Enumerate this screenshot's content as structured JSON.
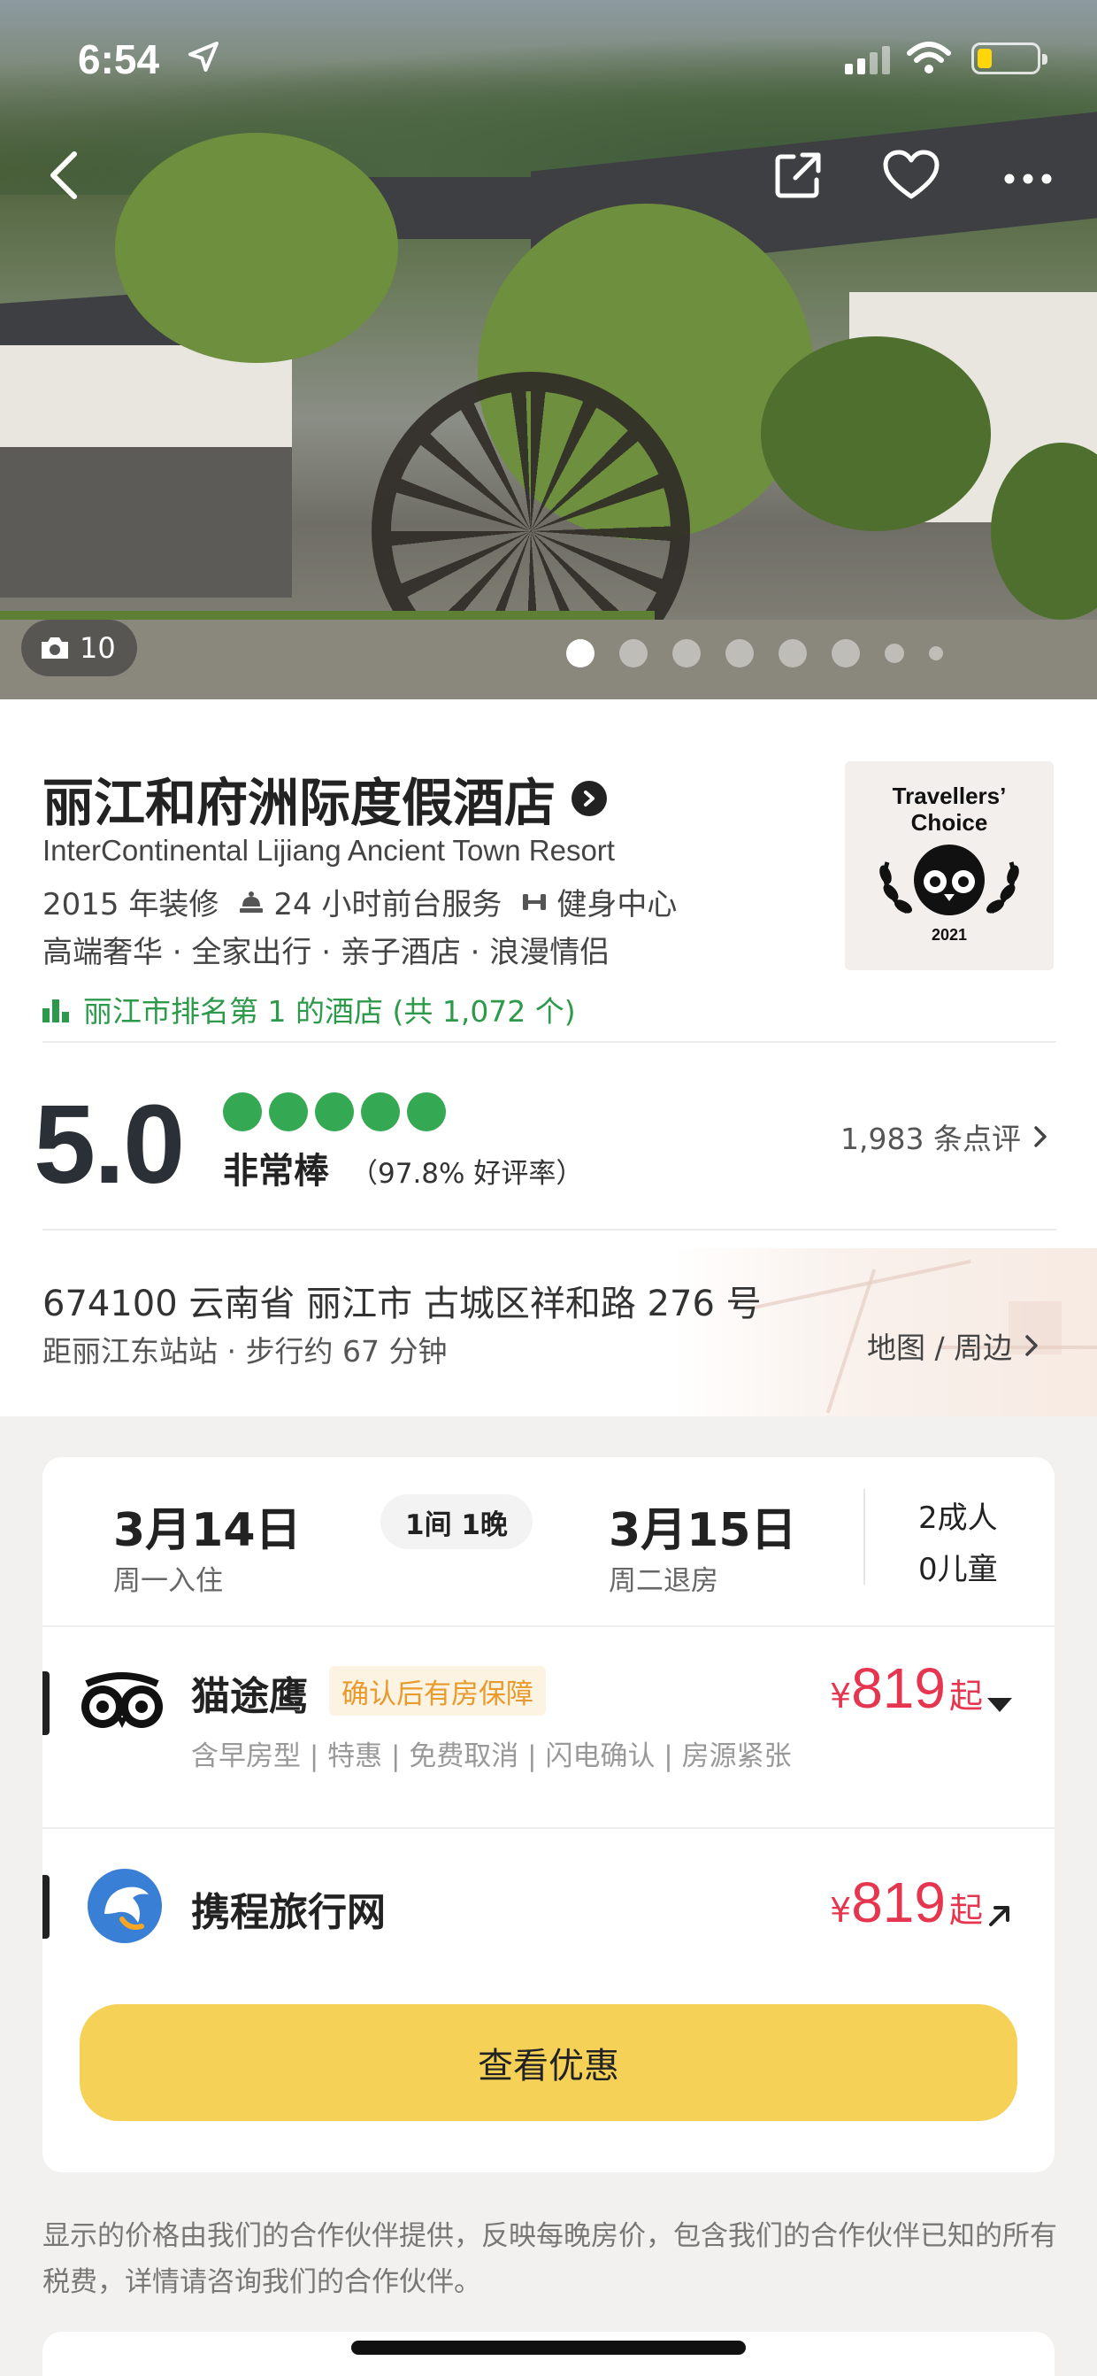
{
  "status_bar": {
    "time": "6:54"
  },
  "hero": {
    "photo_count": "10",
    "dot_count": 8
  },
  "hotel": {
    "name": "丽江和府洲际度假酒店",
    "name_en": "InterContinental Lijiang Ancient Town Resort",
    "renovated": "2015 年装修",
    "amenity_1": "24 小时前台服务",
    "amenity_2": "健身中心",
    "tags": "高端奢华 · 全家出行 · 亲子酒店 · 浪漫情侣",
    "ranking": "丽江市排名第 1 的酒店 (共 1,072 个)",
    "badge_line1": "Travellers’",
    "badge_line2": "Choice",
    "badge_year": "2021"
  },
  "rating": {
    "score": "5.0",
    "bubbles": 5,
    "verdict": "非常棒",
    "positive_rate": "（97.8% 好评率）",
    "review_count": "1,983 条点评",
    "accent_color": "#34a853"
  },
  "location": {
    "address": "674100 云南省 丽江市 古城区祥和路 276 号",
    "distance": "距丽江东站站 · 步行约 67 分钟",
    "map_link": "地图 / 周边"
  },
  "booking": {
    "checkin_date": "3月14日",
    "checkin_label": "周一入住",
    "nights": "1间 1晚",
    "checkout_date": "3月15日",
    "checkout_label": "周二退房",
    "adults": "2成人",
    "children": "0儿童"
  },
  "providers": [
    {
      "name": "猫途鹰",
      "guarantee": "确认后有房保障",
      "features": "含早房型 | 特惠 | 免费取消 | 闪电确认 | 房源紧张",
      "currency": "¥",
      "price": "819",
      "suffix": "起",
      "icon": "tripadvisor-owl-icon"
    },
    {
      "name": "携程旅行网",
      "currency": "¥",
      "price": "819",
      "suffix": "起",
      "icon": "ctrip-dolphin-icon"
    }
  ],
  "cta": {
    "label": "查看优惠",
    "color": "#f5d158"
  },
  "disclaimer": "显示的价格由我们的合作伙伴提供，反映每晚房价，包含我们的合作伙伴已知的所有税费，详情请咨询我们的合作伙伴。",
  "colors": {
    "price": "#e6364f",
    "rank": "#2c9a4a",
    "guarantee": "#e89a2c"
  }
}
